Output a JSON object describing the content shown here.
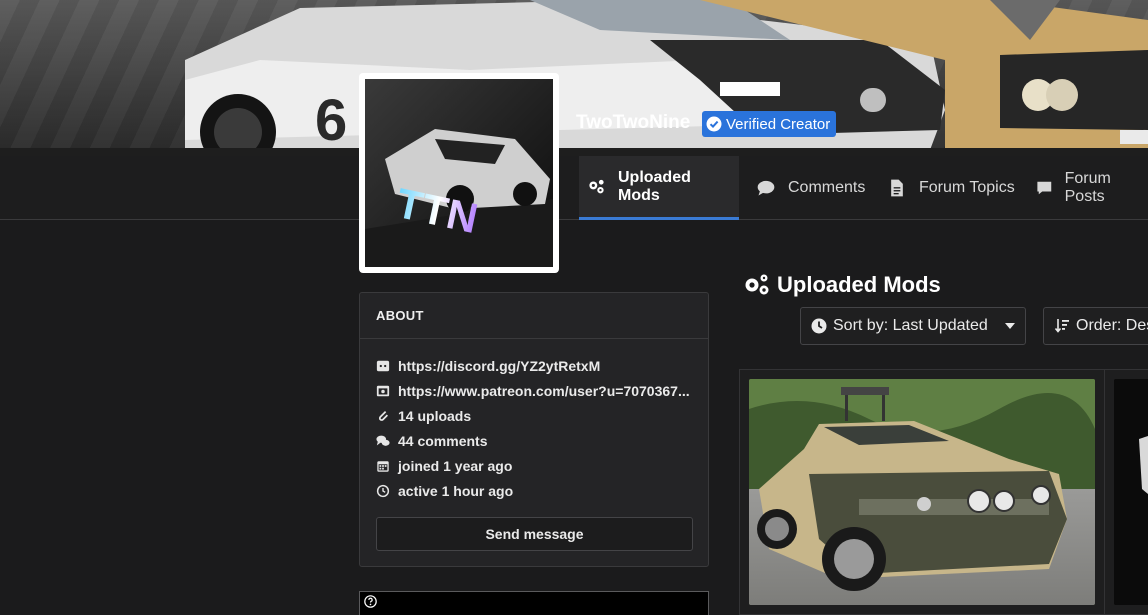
{
  "profile": {
    "username": "TwoTwoNine",
    "verified_label": "Verified Creator"
  },
  "tabs": [
    {
      "label": "Uploaded Mods",
      "icon": "gears-icon",
      "active": true
    },
    {
      "label": "Comments",
      "icon": "comment-icon",
      "active": false
    },
    {
      "label": "Forum Topics",
      "icon": "document-icon",
      "active": false
    },
    {
      "label": "Forum Posts",
      "icon": "message-icon",
      "active": false
    }
  ],
  "about": {
    "title": "ABOUT",
    "items": [
      {
        "icon": "discord-icon",
        "text": "https://discord.gg/YZ2ytRetxM"
      },
      {
        "icon": "patreon-icon",
        "text": "https://www.patreon.com/user?u=7070367..."
      },
      {
        "icon": "paperclip-icon",
        "text": "14 uploads"
      },
      {
        "icon": "comments-icon",
        "text": "44 comments"
      },
      {
        "icon": "calendar-icon",
        "text": "joined 1 year ago"
      },
      {
        "icon": "clock-icon",
        "text": "active 1 hour ago"
      }
    ],
    "send_label": "Send message"
  },
  "mods": {
    "title": "Uploaded Mods",
    "sort_label": "Sort by: Last Updated",
    "order_label": "Order: Descending"
  },
  "avatar_text": "TTN",
  "colors": {
    "accent": "#2a73db",
    "tab_underline": "#3a7bd5",
    "background": "#1b1b1c",
    "panel": "#242426"
  }
}
